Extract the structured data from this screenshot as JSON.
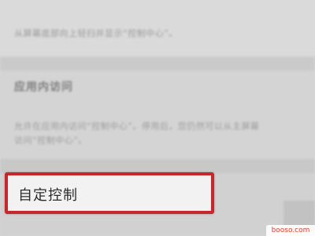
{
  "top_note": "从屏幕底部向上轻扫并显示“控制中心”。",
  "section": {
    "header": "应用内访问",
    "desc_line1": "允许在应用内访问“控制中心”。停用后，您仍然可以从主屏幕",
    "desc_line2": "访问“控制中心”。"
  },
  "custom_control": {
    "label": "自定控制",
    "highlight_color": "#c5282a"
  },
  "watermark": {
    "text": "booso.com"
  }
}
